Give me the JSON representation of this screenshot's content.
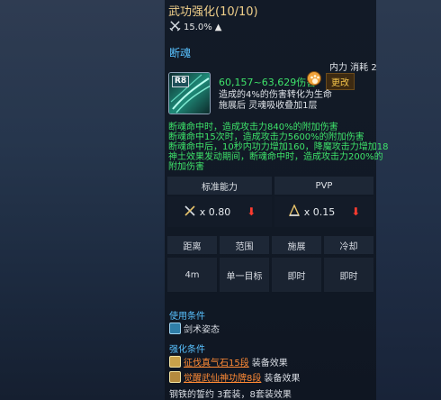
{
  "title": "武功强化(10/10)",
  "stat": {
    "value": "15.0%",
    "trend": "▲",
    "icon": "crossed-swords-icon"
  },
  "skill": {
    "name": "断魂",
    "cost": "内力 消耗 2",
    "icon_tag": "R8",
    "damage": "60,157~63,629伤害",
    "change_label": "更改",
    "desc": [
      "造成的4%的伤害转化为生命",
      "施展后 灵魂吸收叠加1层"
    ]
  },
  "effects": [
    "断魂命中时，造成攻击力840%的附加伤害",
    "断魂命中15次时，造成攻击力5600%的附加伤害",
    "断魂命中后，10秒内功力增加160，降魔攻击力增加18",
    "神土效果发动期间，断魂命中时，造成攻击力200%的",
    "附加伤害"
  ],
  "compare": {
    "standard_label": "标准能力",
    "pvp_label": "PVP",
    "standard_value": "x 0.80",
    "pvp_value": "x 0.15",
    "down_arrow": "⬇"
  },
  "props": {
    "headers": [
      "距离",
      "范围",
      "施展",
      "冷却"
    ],
    "values": [
      "4m",
      "单一目标",
      "即时",
      "即时"
    ]
  },
  "conditions": {
    "use_label": "使用条件",
    "use_item": "剑术姿态",
    "enhance_label": "强化条件",
    "items": [
      {
        "link": "征伐真气石15段",
        "suffix": "装备效果"
      },
      {
        "link": "觉醒武仙神功牌8段",
        "suffix": "装备效果"
      }
    ],
    "footer": "钢铁的誓约 3套装，8套装效果"
  },
  "colors": {
    "gold": "#f1d08b",
    "cyan": "#59c2ff",
    "green": "#3ee36a",
    "orange": "#ff8a35",
    "red": "#ff3b2f"
  }
}
